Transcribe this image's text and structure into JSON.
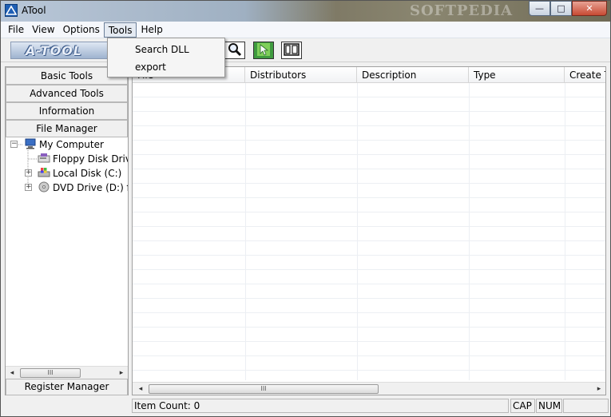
{
  "window": {
    "title": "ATool",
    "watermark": "SOFTPEDIA"
  },
  "window_controls": {
    "minimize": "—",
    "maximize": "□",
    "close": "✕"
  },
  "menubar": {
    "items": [
      "File",
      "View",
      "Options",
      "Tools",
      "Help"
    ],
    "open_item": "Tools"
  },
  "dropdown": {
    "items": [
      "Search DLL",
      "export"
    ]
  },
  "toolbar": {
    "logo_text": "A-TOOL"
  },
  "left_panel": {
    "nav": [
      "Basic Tools",
      "Advanced Tools",
      "Information",
      "File Manager"
    ],
    "tree": {
      "root": "My Computer",
      "children": [
        "Floppy Disk Drive",
        "Local Disk (C:)",
        "DVD Drive (D:) fin"
      ]
    },
    "register_label": "Register Manager"
  },
  "list": {
    "columns": [
      "File",
      "Distributors",
      "Description",
      "Type",
      "Create Ti"
    ]
  },
  "statusbar": {
    "item_count": "Item Count: 0",
    "cap": "CAP",
    "num": "NUM"
  },
  "scroll": {
    "thumb_glyph": "III",
    "left": "◂",
    "right": "▸"
  },
  "colors": {
    "accent": "#1f5fb5",
    "menu_highlight": "#e4eaf2"
  }
}
